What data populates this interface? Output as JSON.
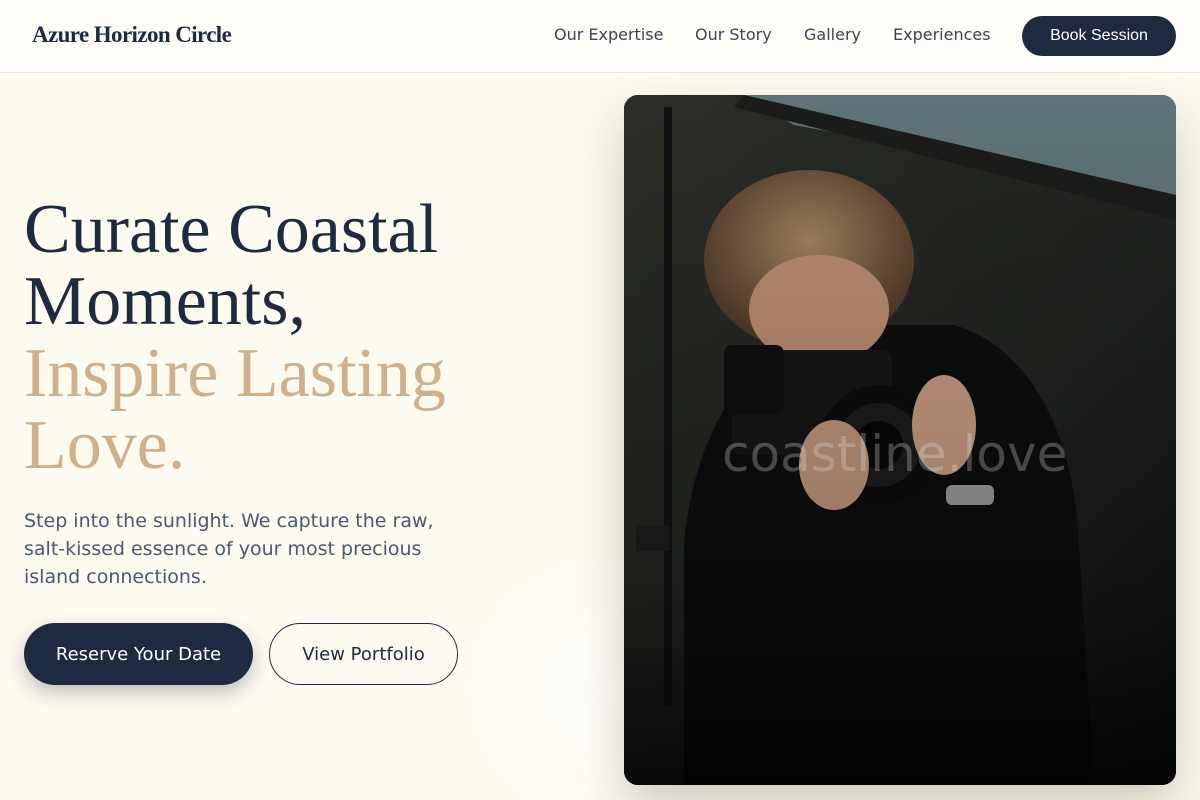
{
  "brand": {
    "name": "Azure Horizon Circle"
  },
  "nav": {
    "items": [
      {
        "label": "Our Expertise"
      },
      {
        "label": "Our Story"
      },
      {
        "label": "Gallery"
      },
      {
        "label": "Experiences"
      }
    ],
    "cta_label": "Book Session"
  },
  "hero": {
    "title_line1": "Curate Coastal",
    "title_line2": "Moments,",
    "title_accent_line1": "Inspire Lasting",
    "title_accent_line2": "Love.",
    "subtitle": "Step into the sunlight. We capture the raw, salt-kissed essence of your most precious island connections.",
    "primary_button": "Reserve Your Date",
    "secondary_button": "View Portfolio",
    "image_watermark": "coastline.love",
    "image_semantic": "photographer-with-camera"
  },
  "colors": {
    "primary": "#1e2a40",
    "accent": "#cfb08a",
    "background": "#fdfaf0"
  }
}
